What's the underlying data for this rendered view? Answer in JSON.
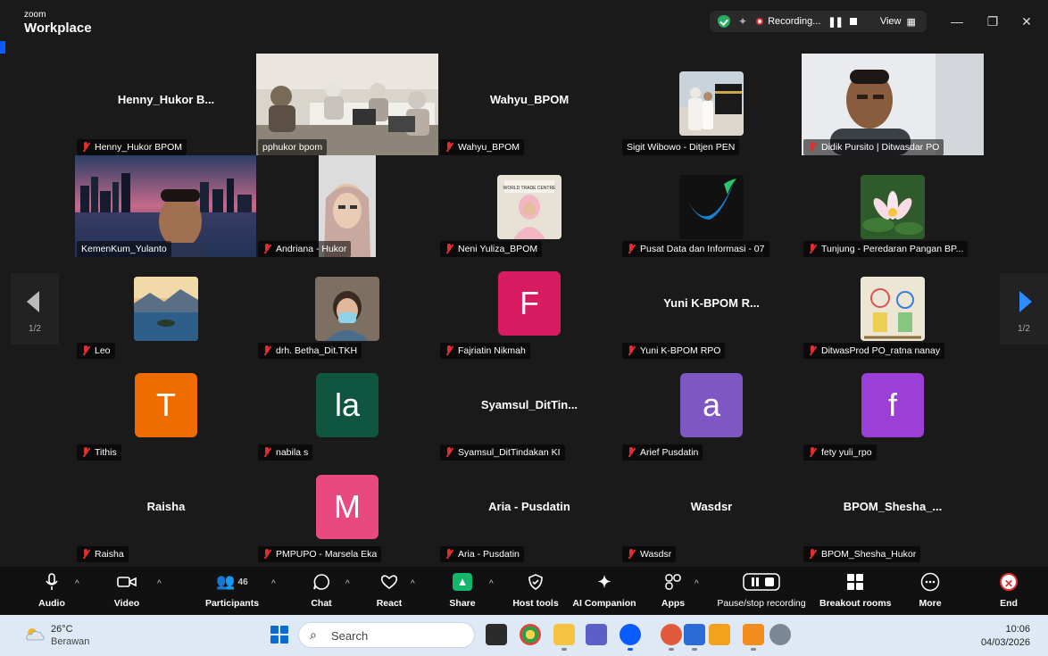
{
  "titlebar": {
    "brand_small": "zoom",
    "brand_big": "Workplace",
    "recording_label": "Recording...",
    "view_label": "View",
    "minimize": "—",
    "restore": "❐",
    "close": "✕"
  },
  "gallery": {
    "page_left": "1/2",
    "page_right": "1/2",
    "tiles": [
      {
        "label": "Henny_Hukor BPOM",
        "display": "Henny_Hukor  B...",
        "kind": "name",
        "muted": true
      },
      {
        "label": "pphukor bpom",
        "kind": "video",
        "muted": false
      },
      {
        "label": "Wahyu_BPOM",
        "display": "Wahyu_BPOM",
        "kind": "name",
        "muted": true
      },
      {
        "label": "Sigit Wibowo - Ditjen PEN",
        "kind": "photo",
        "muted": false
      },
      {
        "label": "Didik Pursito | Ditwasdar PO",
        "kind": "video",
        "muted": true
      },
      {
        "label": "KemenKum_Yulanto",
        "kind": "video",
        "muted": false
      },
      {
        "label": "Andriana - Hukor",
        "kind": "video",
        "muted": true
      },
      {
        "label": "Neni Yuliza_BPOM",
        "kind": "photo",
        "muted": true
      },
      {
        "label": "Pusat Data dan Informasi - 07",
        "kind": "photo",
        "muted": true
      },
      {
        "label": "Tunjung - Peredaran Pangan BP...",
        "kind": "photo",
        "muted": true
      },
      {
        "label": "Leo",
        "kind": "photo",
        "muted": true
      },
      {
        "label": "drh. Betha_Dit.TKH",
        "kind": "photo",
        "muted": true
      },
      {
        "label": "Fajriatin Nikmah",
        "initial": "F",
        "color": "#d81b60",
        "kind": "avatar",
        "muted": true
      },
      {
        "label": "Yuni K-BPOM RPO",
        "display": "Yuni  K-BPOM  R...",
        "kind": "name",
        "muted": true
      },
      {
        "label": "DitwasProd PO_ratna nanay",
        "kind": "photo",
        "muted": true
      },
      {
        "label": "Tithis",
        "initial": "T",
        "color": "#ef6c00",
        "kind": "avatar",
        "muted": true
      },
      {
        "label": "nabila s",
        "initial": "la",
        "color": "#0f5540",
        "kind": "avatar",
        "muted": true
      },
      {
        "label": "Syamsul_DitTindakan KI",
        "display": "Syamsul_DitTin...",
        "kind": "name",
        "muted": true
      },
      {
        "label": "Arief Pusdatin",
        "initial": "a",
        "color": "#7e57c2",
        "kind": "avatar",
        "muted": true
      },
      {
        "label": "fety yuli_rpo",
        "initial": "f",
        "color": "#9c3fd6",
        "kind": "avatar",
        "muted": true
      },
      {
        "label": "Raisha",
        "display": "Raisha",
        "kind": "name",
        "muted": true
      },
      {
        "label": "PMPUPO - Marsela Eka",
        "initial": "M",
        "color": "#e84a7f",
        "kind": "avatar",
        "muted": true
      },
      {
        "label": "Aria - Pusdatin",
        "display": "Aria - Pusdatin",
        "kind": "name",
        "muted": true
      },
      {
        "label": "Wasdsr",
        "display": "Wasdsr",
        "kind": "name",
        "muted": true
      },
      {
        "label": "BPOM_Shesha_Hukor",
        "display": "BPOM_Shesha_...",
        "kind": "name",
        "muted": true
      }
    ]
  },
  "toolbar": {
    "audio": "Audio",
    "video": "Video",
    "participants": "Participants",
    "participants_count": "46",
    "chat": "Chat",
    "react": "React",
    "share": "Share",
    "host_tools": "Host tools",
    "ai_companion": "AI Companion",
    "apps": "Apps",
    "pause_stop": "Pause/stop recording",
    "breakout": "Breakout rooms",
    "more": "More",
    "end": "End"
  },
  "taskbar": {
    "temperature": "26°C",
    "condition": "Berawan",
    "search_placeholder": "Search",
    "time": "10:06",
    "date": "04/03/2026"
  },
  "colors": {
    "active_speaker": "#23d18b",
    "share_green": "#12b76a",
    "muted_red": "#e02f2f",
    "zoom_blue": "#0b5cff"
  }
}
